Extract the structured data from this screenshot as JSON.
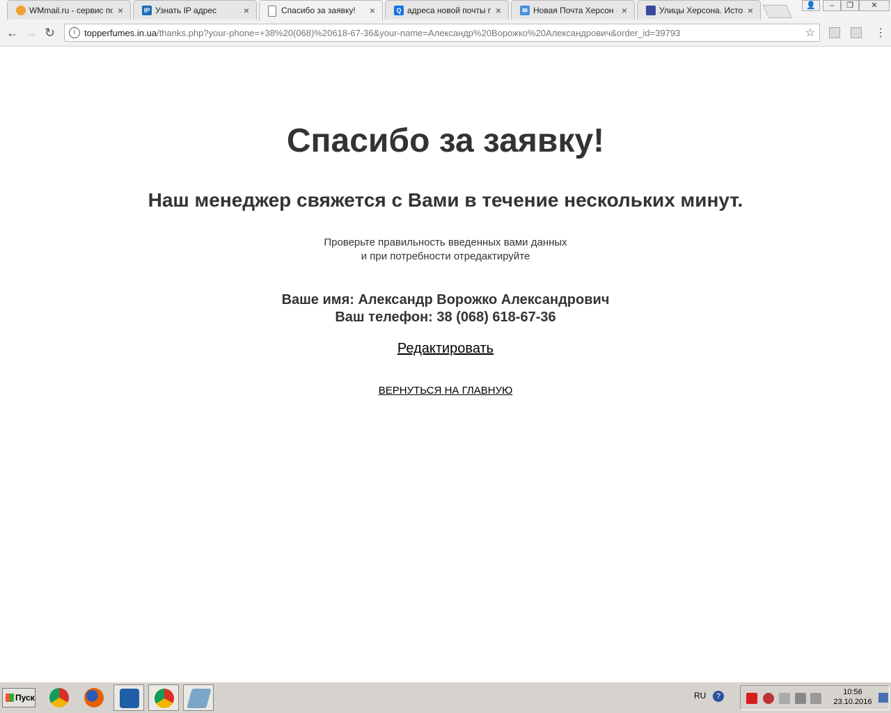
{
  "browser": {
    "tabs": [
      {
        "label": "WMmail.ru - сервис почт",
        "icon": "wmmail-favicon",
        "color": "#f0a030"
      },
      {
        "label": "Узнать IP адрес",
        "icon": "ip-favicon",
        "color": "#1a6fb5"
      },
      {
        "label": "Спасибо за заявку!",
        "icon": "page-icon",
        "color": "#ffffff",
        "active": true
      },
      {
        "label": "адреса новой почты гор",
        "icon": "search-favicon",
        "color": "#1a73e8"
      },
      {
        "label": "Новая Почта Херсон - а",
        "icon": "mail-favicon",
        "color": "#4a8fd8"
      },
      {
        "label": "Улицы Херсона. Истори",
        "icon": "site-favicon",
        "color": "#3a4a9a"
      }
    ],
    "close_glyph": "×",
    "url_host": "topperfumes.in.ua",
    "url_path": "/thanks.php?your-phone=+38%20(068)%20618-67-36&your-name=Александр%20Ворожко%20Александрович&order_id=39793",
    "star": "☆"
  },
  "page": {
    "title": "Спасибо за заявку!",
    "subtitle": "Наш менеджер свяжется с Вами в течение нескольких минут.",
    "check_line1": "Проверьте правильность введенных вами данных",
    "check_line2": "и при потребности отредактируйте",
    "name_line": "Ваше имя: Александр Ворожко Александрович",
    "phone_line": "Ваш телефон: 38 (068) 618-67-36",
    "edit_link": "Редактировать",
    "home_link": "ВЕРНУТЬСЯ НА ГЛАВНУЮ"
  },
  "taskbar": {
    "start_label": "Пуск",
    "apps": [
      {
        "name": "chrome-icon",
        "color": "#d93025"
      },
      {
        "name": "firefox-icon",
        "color": "#e66000"
      },
      {
        "name": "app-blue-icon",
        "color": "#1f5fa8"
      },
      {
        "name": "chrome-icon",
        "color": "#d93025",
        "pressed": true
      },
      {
        "name": "notepad-icon",
        "color": "#7aa7c7"
      }
    ],
    "lang": "RU",
    "time": "10:56",
    "date": "23.10.2016"
  }
}
